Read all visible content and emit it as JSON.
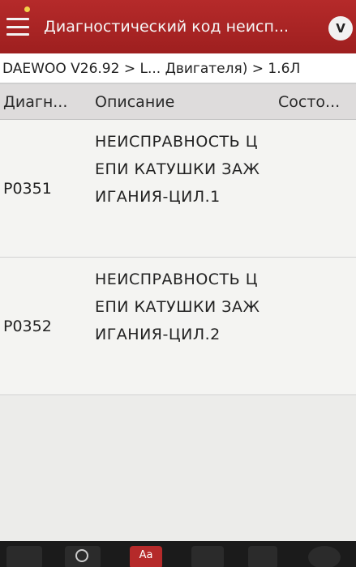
{
  "title": "Диагностический код неисп...",
  "breadcrumb": "DAEWOO V26.92 > L... Двигателя) > 1.6Л",
  "columns": {
    "code": "Диагн...",
    "description": "Описание",
    "state": "Состо..."
  },
  "rows": [
    {
      "code": "P0351",
      "description": "НЕИСПРАВНОСТЬ ЦЕПИ КАТУШКИ ЗАЖИГАНИЯ-ЦИЛ.1",
      "state": ""
    },
    {
      "code": "P0352",
      "description": "НЕИСПРАВНОСТЬ ЦЕПИ КАТУШКИ ЗАЖИГАНИЯ-ЦИЛ.2",
      "state": ""
    }
  ],
  "toolbar": {
    "font_button_label": "Aa"
  },
  "colors": {
    "titlebar": "#b52a2a",
    "background": "#ececea"
  },
  "icons": [
    "menu-icon",
    "vci-icon",
    "car-icon",
    "search-icon",
    "font-size-icon",
    "calendar-icon",
    "share-icon",
    "help-icon"
  ]
}
